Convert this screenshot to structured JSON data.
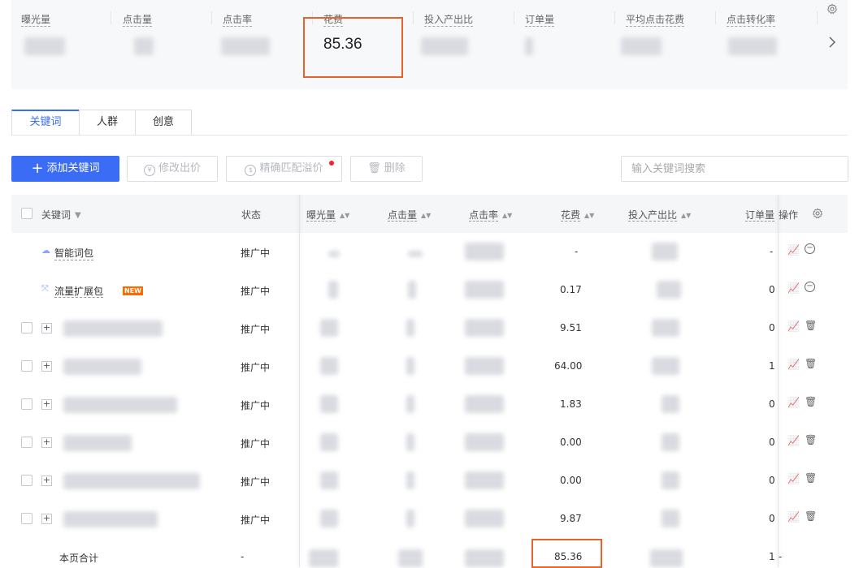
{
  "metrics": [
    {
      "label": "曝光量",
      "value": ""
    },
    {
      "label": "点击量",
      "value": ""
    },
    {
      "label": "点击率",
      "value": ""
    },
    {
      "label": "花费",
      "value": "85.36"
    },
    {
      "label": "投入产出比",
      "value": ""
    },
    {
      "label": "订单量",
      "value": ""
    },
    {
      "label": "平均点击花费",
      "value": ""
    },
    {
      "label": "点击转化率",
      "value": ""
    }
  ],
  "tabs": [
    "关键词",
    "人群",
    "创意"
  ],
  "toolbar": {
    "add_keyword": "添加关键词",
    "modify_bid": "修改出价",
    "precise_match": "精确匹配溢价",
    "delete": "删除",
    "search_placeholder": "输入关键词搜索"
  },
  "table": {
    "headers": {
      "keyword": "关键词",
      "status": "状态",
      "impressions": "曝光量",
      "clicks": "点击量",
      "ctr": "点击率",
      "cost": "花费",
      "roi": "投入产出比",
      "orders": "订单量",
      "actions": "操作"
    },
    "rows": [
      {
        "keyword": "智能词包",
        "status": "推广中",
        "cost": "-",
        "orders": "-"
      },
      {
        "keyword": "流量扩展包",
        "badge": "NEW",
        "status": "推广中",
        "cost": "0.17",
        "orders": "0"
      },
      {
        "keyword": "",
        "status": "推广中",
        "cost": "9.51",
        "orders": "0"
      },
      {
        "keyword": "",
        "status": "推广中",
        "cost": "64.00",
        "orders": "1"
      },
      {
        "keyword": "",
        "status": "推广中",
        "cost": "1.83",
        "orders": "0"
      },
      {
        "keyword": "",
        "status": "推广中",
        "cost": "0.00",
        "orders": "0"
      },
      {
        "keyword": "",
        "status": "推广中",
        "cost": "0.00",
        "orders": "0"
      },
      {
        "keyword": "",
        "status": "推广中",
        "cost": "9.87",
        "orders": "0"
      }
    ],
    "total": {
      "label": "本页合计",
      "status": "-",
      "cost": "85.36",
      "orders": "1",
      "actions": "-"
    }
  },
  "colors": {
    "primary": "#3b6cf6",
    "highlight": "#e8632b",
    "new_badge": "#ff6a00"
  }
}
